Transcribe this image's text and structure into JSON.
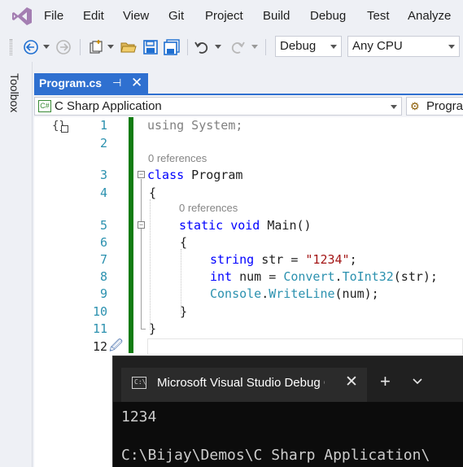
{
  "menu": [
    "File",
    "Edit",
    "View",
    "Git",
    "Project",
    "Build",
    "Debug",
    "Test",
    "Analyze"
  ],
  "toolbar": {
    "config": "Debug",
    "platform": "Any CPU"
  },
  "toolbox_label": "Toolbox",
  "tab": {
    "title": "Program.cs",
    "pin": "⊣",
    "close": "✕"
  },
  "navbar": {
    "project": "C Sharp Application",
    "member": "Progra"
  },
  "editor": {
    "line_numbers": [
      "1",
      "2",
      "3",
      "4",
      "5",
      "6",
      "7",
      "8",
      "9",
      "10",
      "11",
      "12"
    ],
    "refs_class": "0 references",
    "refs_method": "0 references",
    "l1_kw": "using",
    "l1_rest": " System;",
    "l3_kw": "class",
    "l3_rest": " Program",
    "l4": "{",
    "l5_kw1": "static",
    "l5_kw2": "void",
    "l5_rest": " Main()",
    "l6": "{",
    "l7_kw": "string",
    "l7_mid": " str = ",
    "l7_str": "\"1234\"",
    "l7_end": ";",
    "l8_kw": "int",
    "l8_mid": " num = ",
    "l8_typ": "Convert",
    "l8_dot": ".",
    "l8_meth": "ToInt32",
    "l8_end": "(str);",
    "l9_typ": "Console",
    "l9_dot": ".",
    "l9_meth": "WriteLine",
    "l9_end": "(num);",
    "l10": "}",
    "l11": "}"
  },
  "terminal": {
    "tab_title": "Microsoft Visual Studio Debug Console",
    "tab_icon": "C:\\",
    "plus": "+",
    "close": "✕",
    "output": "1234",
    "path": "C:\\Bijay\\Demos\\C Sharp Application\\"
  },
  "colors": {
    "accent": "#2f70d0",
    "keyword": "#0000ff",
    "string": "#a31515",
    "type": "#2b91af",
    "change_bar": "#107c10"
  }
}
